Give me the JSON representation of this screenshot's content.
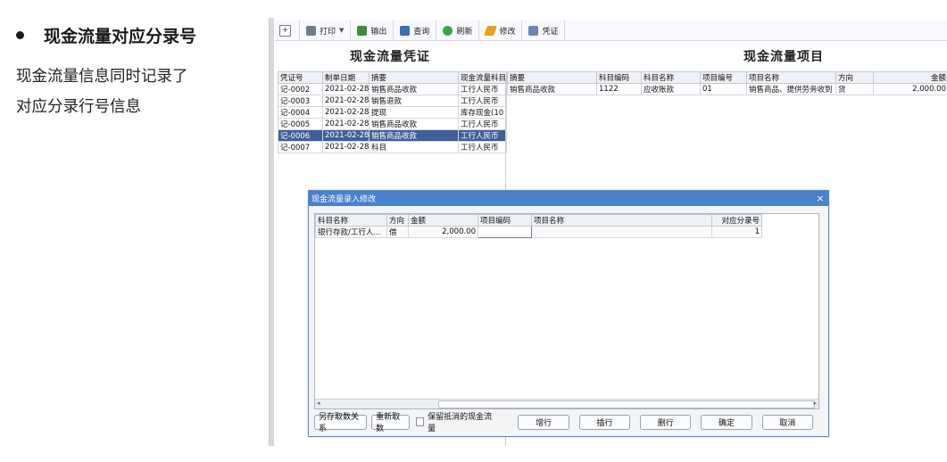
{
  "intro": {
    "heading": "现金流量对应分录号",
    "lines": [
      "现金流量信息同时记录了",
      "对应分录行号信息"
    ]
  },
  "toolbar": {
    "new_icon_label": "+",
    "print": "打印",
    "export": "输出",
    "query": "查询",
    "refresh": "刷新",
    "edit": "修改",
    "voucher": "凭证"
  },
  "left_panel": {
    "title": "现金流量凭证",
    "columns": [
      "凭证号",
      "制单日期",
      "摘要",
      "现金流量科目"
    ],
    "rows": [
      [
        "记-0002",
        "2021-02-28",
        "销售商品收款",
        "工行人民币"
      ],
      [
        "记-0003",
        "2021-02-28",
        "销售退款",
        "工行人民币"
      ],
      [
        "记-0004",
        "2021-02-28",
        "提现",
        "库存现金(10"
      ],
      [
        "记-0005",
        "2021-02-28",
        "销售商品收款",
        "工行人民币"
      ],
      [
        "记-0006",
        "2021-02-28",
        "销售商品收款",
        "工行人民币"
      ],
      [
        "记-0007",
        "2021-02-28",
        "科目",
        "工行人民币"
      ]
    ],
    "selected_row": 4
  },
  "right_panel": {
    "title": "现金流量项目",
    "columns": [
      "摘要",
      "科目编码",
      "科目名称",
      "项目编号",
      "项目名称",
      "方向",
      "金额"
    ],
    "rows": [
      [
        "销售商品收款",
        "1122",
        "应收账款",
        "01",
        "销售商品、提供劳务收到",
        "贷",
        "2,000.00"
      ]
    ]
  },
  "dialog": {
    "title": "现金流量录入修改",
    "close": "×",
    "columns": [
      "科目名称",
      "方向",
      "金额",
      "项目编码",
      "项目名称",
      "对应分录号"
    ],
    "rows": [
      [
        "银行存款/工行人...",
        "借",
        "2,000.00",
        "",
        "",
        "1"
      ]
    ],
    "buttons": {
      "save_relation": "另存取数关系",
      "refetch": "重新取数",
      "keep_offset": "保留抵消的现金流量",
      "add_row": "增行",
      "insert_row": "插行",
      "delete_row": "删行",
      "ok": "确定",
      "cancel": "取消"
    }
  }
}
